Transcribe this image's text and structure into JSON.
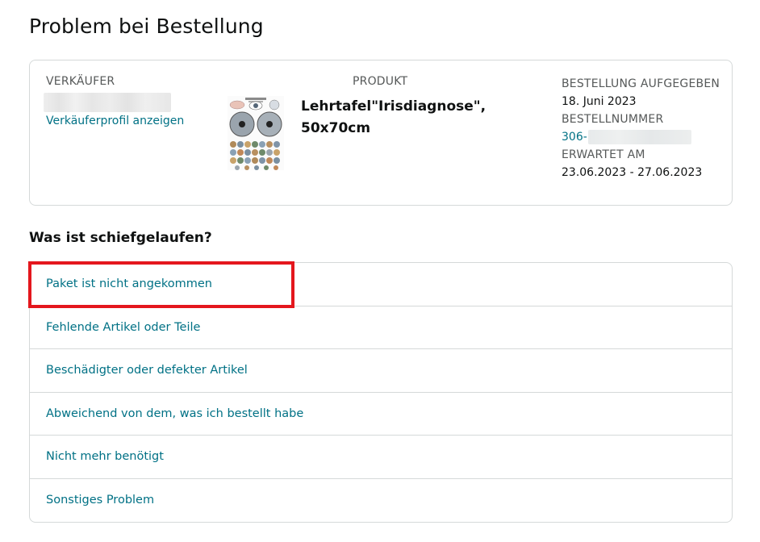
{
  "page": {
    "title": "Problem bei Bestellung"
  },
  "order": {
    "seller_label": "VERKÄUFER",
    "seller_profile_link": "Verkäuferprofil anzeigen",
    "product_label": "PRODUKT",
    "product_title": "Lehrtafel\"Irisdiagnose\", 50x70cm",
    "ordered_label": "BESTELLUNG AUFGEGEBEN",
    "ordered_date": "18. Juni 2023",
    "order_number_label": "BESTELLNUMMER",
    "order_number_prefix": "306-",
    "expected_label": "ERWARTET AM",
    "expected_range": "23.06.2023 - 27.06.2023"
  },
  "problems": {
    "heading": "Was ist schiefgelaufen?",
    "options": [
      "Paket ist nicht angekommen",
      "Fehlende Artikel oder Teile",
      "Beschädigter oder defekter Artikel",
      "Abweichend von dem, was ich bestellt habe",
      "Nicht mehr benötigt",
      "Sonstiges Problem"
    ]
  },
  "colors": {
    "link": "#007185",
    "highlight": "#e4171d",
    "border": "#d5d9d9"
  }
}
